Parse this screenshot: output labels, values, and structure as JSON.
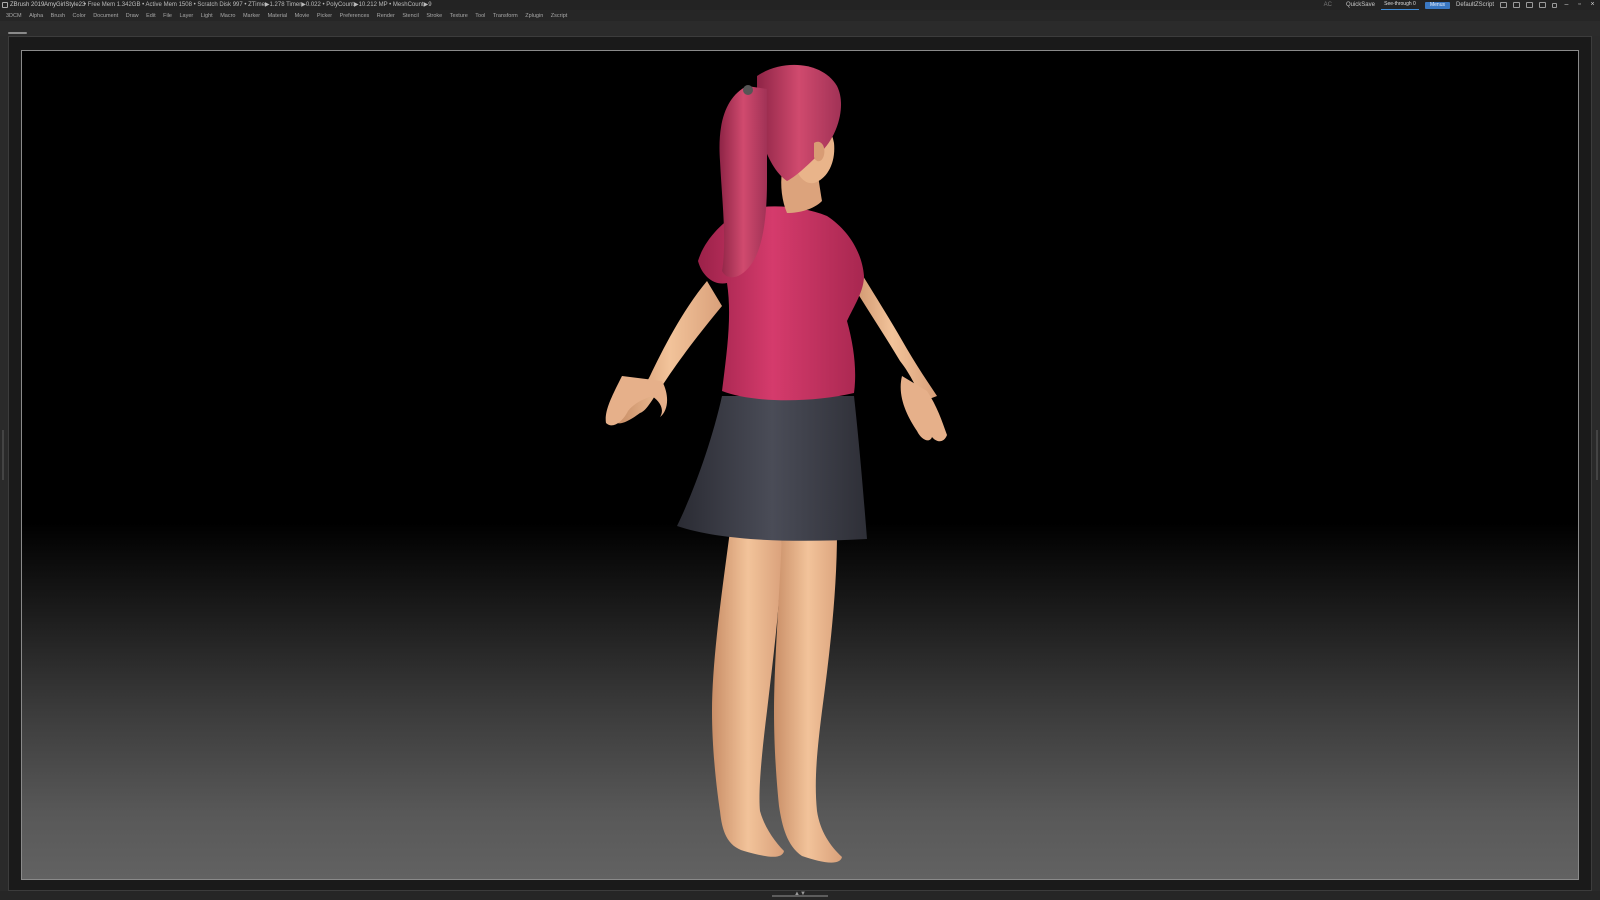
{
  "titlebar": {
    "app_title": "ZBrush 2019",
    "document_name": "AmyGirlStyle23",
    "stats": "• Free Mem 1.342GB • Active Mem 1508 • Scratch Disk 997 • ZTime▶1.278 Timer▶0.022 • PolyCount▶10.212 MP • MeshCount▶9",
    "ac_label": "AC",
    "quicksave_label": "QuickSave",
    "seethrough_label": "See-through 0",
    "seethrough_value": 0,
    "menus_label": "Menus",
    "script_label": "DefaultZScript"
  },
  "menubar": {
    "items": [
      "3DCM",
      "Alpha",
      "Brush",
      "Color",
      "Document",
      "Draw",
      "Edit",
      "File",
      "Layer",
      "Light",
      "Macro",
      "Marker",
      "Material",
      "Movie",
      "Picker",
      "Preferences",
      "Render",
      "Stencil",
      "Stroke",
      "Texture",
      "Tool",
      "Transform",
      "Zplugin",
      "Zscript"
    ]
  },
  "colors": {
    "accent": "#3a78c3",
    "skin": "#e9b48a",
    "shirt": "#c0325e",
    "hair": "#c23e62",
    "skirt": "#3a3c46"
  },
  "icons": {
    "logo": "zbrush-logo-icon",
    "minimize": "minimize-icon",
    "maximize": "maximize-icon",
    "close": "close-icon"
  }
}
